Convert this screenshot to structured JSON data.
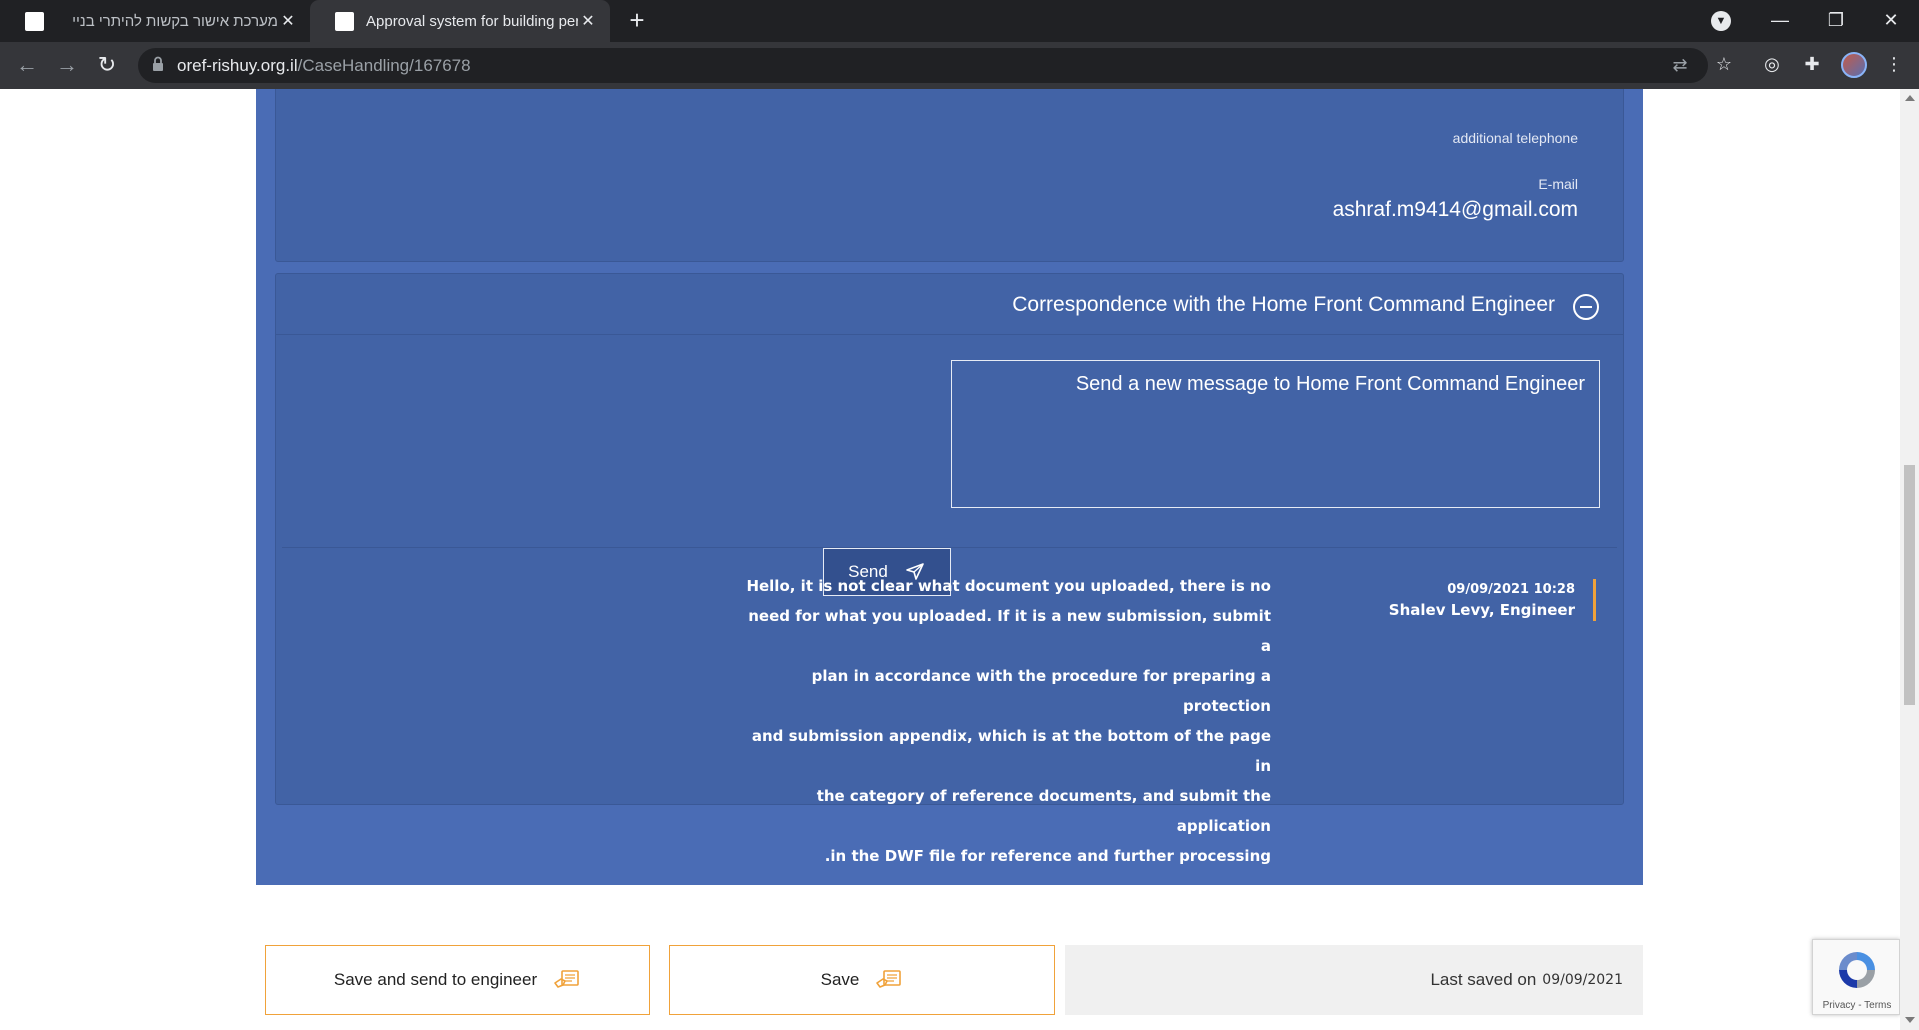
{
  "browser": {
    "tabs": [
      {
        "title": "מערכת אישור בקשות להיתרי בניי",
        "active": false
      },
      {
        "title": "Approval system for building per",
        "active": true
      }
    ],
    "url_domain": "oref-rishuy.org.il",
    "url_path": "/CaseHandling/167678"
  },
  "contact": {
    "additional_telephone_label": "additional telephone",
    "email_label": "E-mail",
    "email_value": "ashraf.m9414@gmail.com"
  },
  "correspondence": {
    "title": "Correspondence with the Home Front Command Engineer",
    "new_message_placeholder": "Send a new message to Home Front Command Engineer",
    "send_label": "Send",
    "messages": [
      {
        "date": "09/09/2021 10:28",
        "author": "Shalev Levy, Engineer",
        "lines": [
          "Hello, it is not clear what document you uploaded, there is no",
          "need for what you uploaded. If it is a new submission, submit a",
          "plan in accordance with the procedure for preparing a protection",
          "and submission appendix, which is at the bottom of the page in",
          "the category of reference documents, and submit the application",
          ".in the DWF file for reference and further processing"
        ]
      }
    ]
  },
  "footer": {
    "save_and_send_label": "Save and send to engineer",
    "save_label": "Save",
    "last_saved_label": "Last saved on",
    "last_saved_date": "09/09/2021"
  },
  "recaptcha": {
    "footer_text": "Privacy - Terms"
  },
  "colors": {
    "panel_blue": "#4a6cb5",
    "card_blue": "#4263a6",
    "accent_orange": "#f0a23a"
  }
}
